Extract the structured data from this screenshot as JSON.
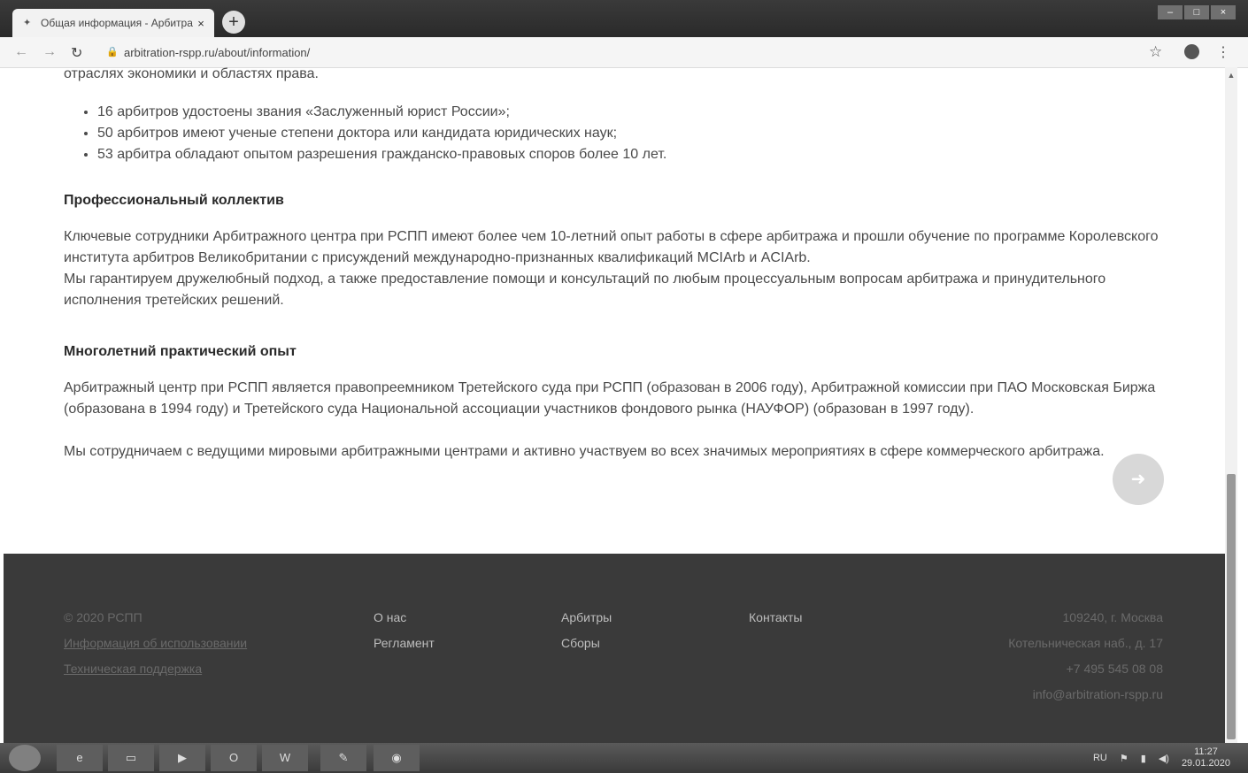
{
  "browser": {
    "tab_title": "Общая информация - Арбитра",
    "tab_close": "×",
    "new_tab": "+",
    "url": "arbitration-rspp.ru/about/information/",
    "window_buttons": [
      "–",
      "□",
      "×"
    ],
    "icons": [
      "back-icon",
      "forward-icon",
      "reload-icon",
      "lock-icon",
      "star-icon",
      "profile-icon",
      "menu-icon"
    ]
  },
  "content": {
    "top_line": "отраслях экономики и областях права.",
    "stats": [
      "16 арбитров удостоены звания «Заслуженный юрист России»;",
      "50 арбитров имеют ученые степени доктора или кандидата юридических наук;",
      "53 арбитра обладают опытом разрешения гражданско-правовых споров более 10 лет."
    ],
    "section1": {
      "heading": "Профессиональный коллектив",
      "p1": "Ключевые сотрудники Арбитражного центра при РСПП имеют более чем 10-летний опыт работы в сфере арбитража и прошли обучение по программе Королевского института арбитров Великобритании с присуждений международно-признанных квалификаций MCIArb и ACIArb.",
      "p2": "Мы гарантируем дружелюбный подход, а также предоставление помощи и консультаций по любым процессуальным вопросам арбитража и принудительного исполнения третейских решений."
    },
    "section2": {
      "heading": "Многолетний практический опыт",
      "p1": "Арбитражный центр при РСПП является правопреемником Третейского суда при РСПП (образован в 2006 году), Арбитражной комиссии при ПАО Московская Биржа (образована в 1994 году) и Третейского суда Национальной ассоциации участников фондового рынка (НАУФОР) (образован в 1997 году).",
      "p2": "Мы сотрудничаем с ведущими мировыми арбитражными центрами и активно участвуем во всех значимых мероприятиях в сфере коммерческого арбитража."
    }
  },
  "footer": {
    "copyright": "© 2020 РСПП",
    "usage_info": "Информация об использовании",
    "support": "Техническая поддержка",
    "about": "О нас",
    "rules": "Регламент",
    "arbitrators": "Арбитры",
    "fees": "Сборы",
    "contacts": "Контакты",
    "address1": "109240, г. Москва",
    "address2": "Котельническая наб., д. 17",
    "phone": "+7 495 545 08 08",
    "email": "info@arbitration-rspp.ru"
  },
  "taskbar": {
    "apps": [
      "ie-icon",
      "explorer-icon",
      "media-player-icon",
      "outlook-icon",
      "word-icon",
      "acrobat-icon",
      "chrome-icon"
    ],
    "lang": "RU",
    "time": "11:27",
    "date": "29.01.2020"
  }
}
